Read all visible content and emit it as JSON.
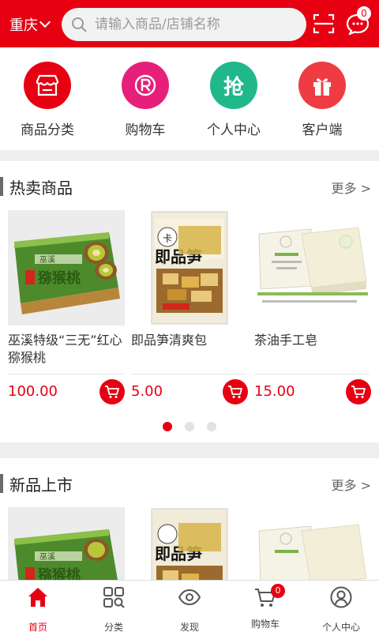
{
  "header": {
    "city": "重庆",
    "search_placeholder": "请输入商品/店铺名称",
    "message_badge": "0",
    "accent_color": "#e60012"
  },
  "quick_nav": [
    {
      "label": "商品分类",
      "icon": "store-icon",
      "color": "#e60012"
    },
    {
      "label": "购物车",
      "icon": "registered-cart-icon",
      "color": "#e6207a"
    },
    {
      "label": "个人中心",
      "icon": "grab-icon",
      "color": "#20b88a",
      "glyph": "抢"
    },
    {
      "label": "客户端",
      "icon": "gift-icon",
      "color": "#ef3b42"
    }
  ],
  "hot": {
    "title": "热卖商品",
    "more": "更多 >",
    "products": [
      {
        "name": "巫溪特级“三无”红心猕猴桃",
        "price": "100.00",
        "image": "kiwi-box-image"
      },
      {
        "name": "即品笋清爽包",
        "price": "5.00",
        "image": "bamboo-shoot-package-image"
      },
      {
        "name": "茶油手工皂",
        "price": "15.00",
        "image": "soap-image"
      }
    ],
    "pager": {
      "count": 3,
      "active": 0
    }
  },
  "new": {
    "title": "新品上市",
    "more": "更多 >",
    "products": [
      {
        "image": "kiwi-box-image"
      },
      {
        "image": "bamboo-shoot-package-image"
      },
      {
        "image": "soap-image"
      }
    ]
  },
  "tabs": [
    {
      "label": "首页",
      "icon": "home-icon",
      "active": true
    },
    {
      "label": "分类",
      "icon": "category-grid-icon",
      "active": false
    },
    {
      "label": "发现",
      "icon": "eye-icon",
      "active": false
    },
    {
      "label": "购物车",
      "icon": "cart-icon",
      "active": false,
      "badge": "0"
    },
    {
      "label": "个人中心",
      "icon": "profile-icon",
      "active": false
    }
  ]
}
